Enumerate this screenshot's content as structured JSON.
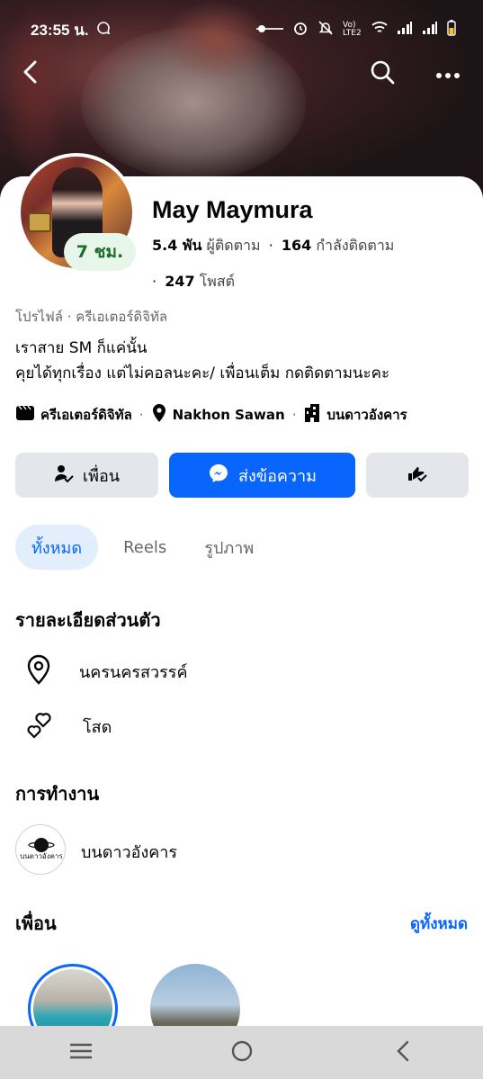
{
  "status_bar": {
    "time": "23:55 น.",
    "network_label": "Vo) LTE2"
  },
  "profile": {
    "name": "May Maymura",
    "story_badge": "7 ชม.",
    "followers_count": "5.4 พัน",
    "followers_label": "ผู้ติดตาม",
    "following_count": "164",
    "following_label": "กำลังติดตาม",
    "posts_count": "247",
    "posts_label": "โพสต์",
    "category_line": "โปรไฟล์ · ครีเอเตอร์ดิจิทัล",
    "bio_line1": "เราสาย SM ก็แค่นั้น",
    "bio_line2": "คุยได้ทุกเรื่อง แต่ไม่คอลนะคะ/ เพื่อนเต็ม กดติดตามนะคะ",
    "info_creator": "ครีเอเตอร์ดิจิทัล",
    "info_location": "Nakhon Sawan",
    "info_workplace": "บนดาวอังคาร"
  },
  "actions": {
    "friends_label": "เพื่อน",
    "message_label": "ส่งข้อความ"
  },
  "tabs": [
    {
      "label": "ทั้งหมด"
    },
    {
      "label": "Reels"
    },
    {
      "label": "รูปภาพ"
    }
  ],
  "personal_details": {
    "title": "รายละเอียดส่วนตัว",
    "location": "นครนครสวรรค์",
    "relationship": "โสด"
  },
  "work": {
    "title": "การทำงาน",
    "place": "บนดาวอังคาร",
    "logo_text": "บนดาวอังคาร"
  },
  "friends": {
    "title": "เพื่อน",
    "see_all": "ดูทั้งหมด"
  },
  "colors": {
    "accent": "#0866ff",
    "button_gray": "#e4e6eb",
    "story_badge_bg": "#e8f5e9",
    "story_badge_text": "#1b6e2a"
  }
}
